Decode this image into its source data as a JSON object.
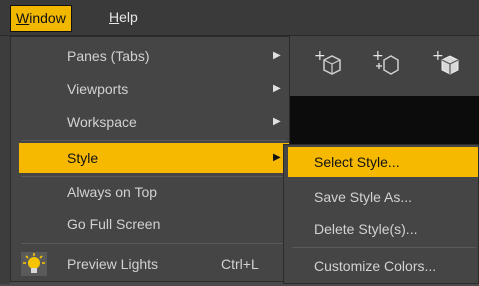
{
  "menubar": {
    "window_label": "Window",
    "window_mnemonic": "W",
    "window_rest": "indow",
    "help_mnemonic": "H",
    "help_rest": "elp"
  },
  "window_menu": {
    "items": [
      {
        "label": "Panes (Tabs)",
        "has_submenu": true
      },
      {
        "label": "Viewports",
        "has_submenu": true
      },
      {
        "label": "Workspace",
        "has_submenu": true
      },
      {
        "label": "Style",
        "has_submenu": true,
        "highlighted": true
      },
      {
        "label": "Always on Top"
      },
      {
        "label": "Go Full Screen"
      },
      {
        "label": "Preview Lights",
        "shortcut": "Ctrl+L",
        "icon": "light-bulb-icon"
      }
    ],
    "arrow_glyph": "▶"
  },
  "style_submenu": {
    "items": [
      {
        "label": "Select Style...",
        "highlighted": true
      },
      {
        "label": "Save Style As..."
      },
      {
        "label": "Delete Style(s)..."
      },
      {
        "label": "Customize Colors..."
      }
    ]
  },
  "colors": {
    "highlight": "#f6b900",
    "menu_bg": "#454545",
    "menubar_bg": "#3a3a3a",
    "text": "#d2d2d2"
  },
  "background_tools": {
    "icons": [
      "add-node-icon",
      "add-null-icon",
      "add-cube-icon"
    ]
  }
}
